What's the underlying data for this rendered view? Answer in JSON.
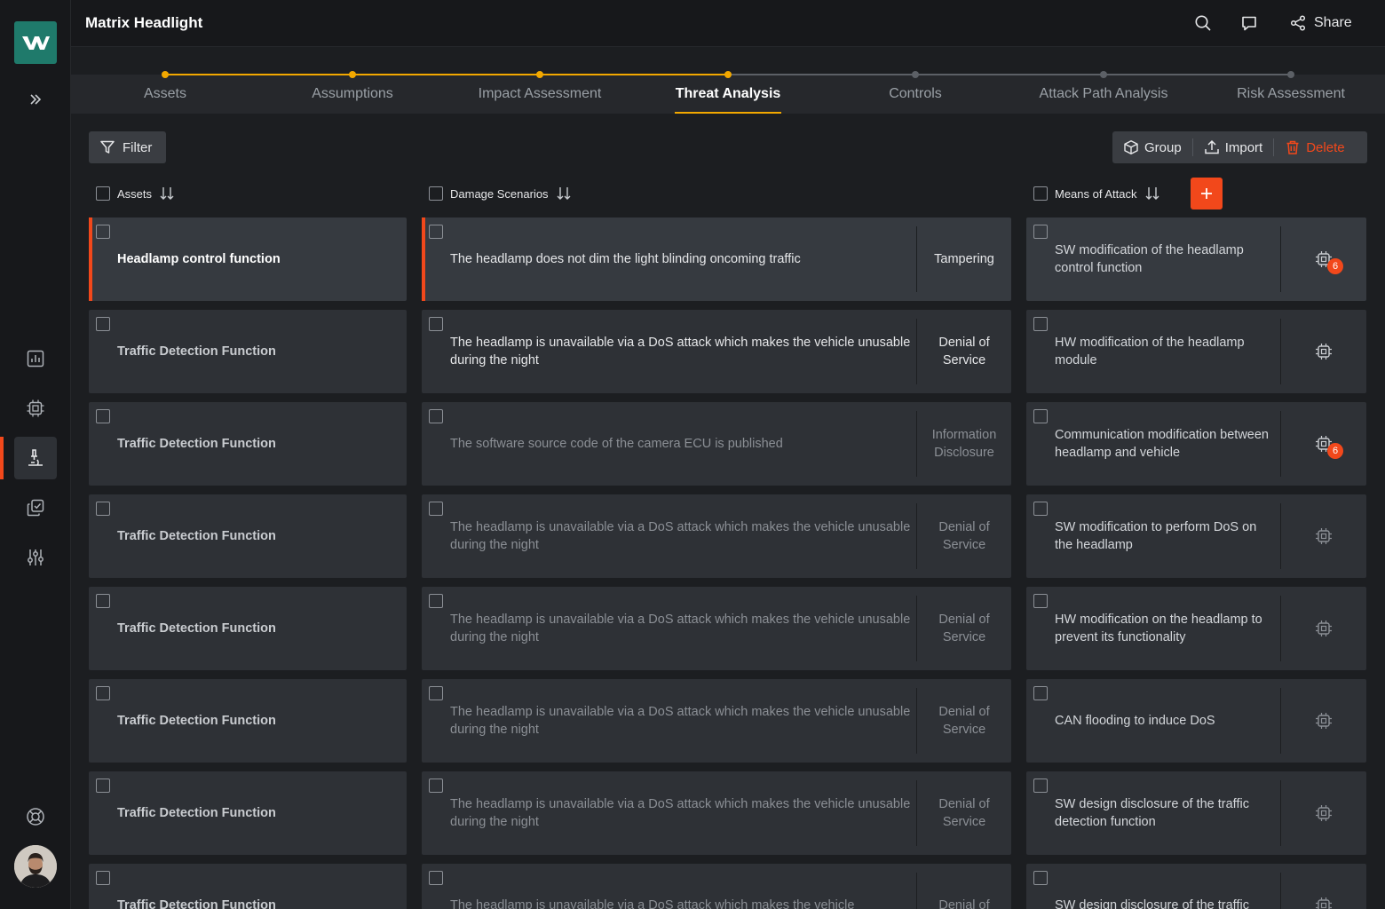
{
  "app": {
    "title": "Matrix Headlight"
  },
  "topbar": {
    "share_label": "Share"
  },
  "stepper": {
    "steps": [
      "Assets",
      "Assumptions",
      "Impact Assessment",
      "Threat Analysis",
      "Controls",
      "Attack Path Analysis",
      "Risk Assessment"
    ],
    "active_index": 3,
    "colors": {
      "done": "#f2a800",
      "todo": "#5c6066"
    }
  },
  "toolbar": {
    "filter_label": "Filter",
    "group_label": "Group",
    "import_label": "Import",
    "delete_label": "Delete"
  },
  "columns": {
    "assets": "Assets",
    "damage_scenarios": "Damage Scenarios",
    "means_of_attack": "Means of Attack"
  },
  "rows": [
    {
      "asset": "Headlamp control function",
      "damage": "The headlamp does not dim the light blinding oncoming traffic",
      "type": "Tampering",
      "attack": "SW modification of the headlamp control function",
      "badge": "6"
    },
    {
      "asset": "Traffic Detection Function",
      "damage": "The headlamp is unavailable via a DoS attack which makes the vehicle unusable during the night",
      "type": "Denial of Service",
      "attack": "HW modification of the headlamp module",
      "badge": ""
    },
    {
      "asset": "Traffic Detection Function",
      "damage": "The software source code of the camera ECU is published",
      "type": "Information Disclosure",
      "attack": "Communication modification between headlamp and vehicle",
      "badge": "6"
    },
    {
      "asset": "Traffic Detection Function",
      "damage": "The headlamp is unavailable via a DoS attack which makes the vehicle unusable during the night",
      "type": "Denial of Service",
      "attack": "SW modification to perform DoS on the headlamp",
      "badge": ""
    },
    {
      "asset": "Traffic Detection Function",
      "damage": "The headlamp is unavailable via a DoS attack which makes the vehicle unusable during the night",
      "type": "Denial of Service",
      "attack": "HW modification on the headlamp to prevent its functionality",
      "badge": ""
    },
    {
      "asset": "Traffic Detection Function",
      "damage": "The headlamp is unavailable via a DoS attack which makes the vehicle unusable during the night",
      "type": "Denial of Service",
      "attack": "CAN flooding to induce DoS",
      "badge": ""
    },
    {
      "asset": "Traffic Detection Function",
      "damage": "The headlamp is unavailable via a DoS attack which makes the vehicle unusable during the night",
      "type": "Denial of Service",
      "attack": "SW design disclosure of the traffic detection function",
      "badge": ""
    },
    {
      "asset": "Traffic Detection Function",
      "damage": "The headlamp is unavailable via a DoS attack which makes the vehicle",
      "type": "Denial of",
      "attack": "SW design disclosure of the traffic",
      "badge": ""
    }
  ],
  "theme": {
    "accent": "#f2481b",
    "progress": "#f2a800",
    "logo_bg": "#1f7a6b"
  }
}
